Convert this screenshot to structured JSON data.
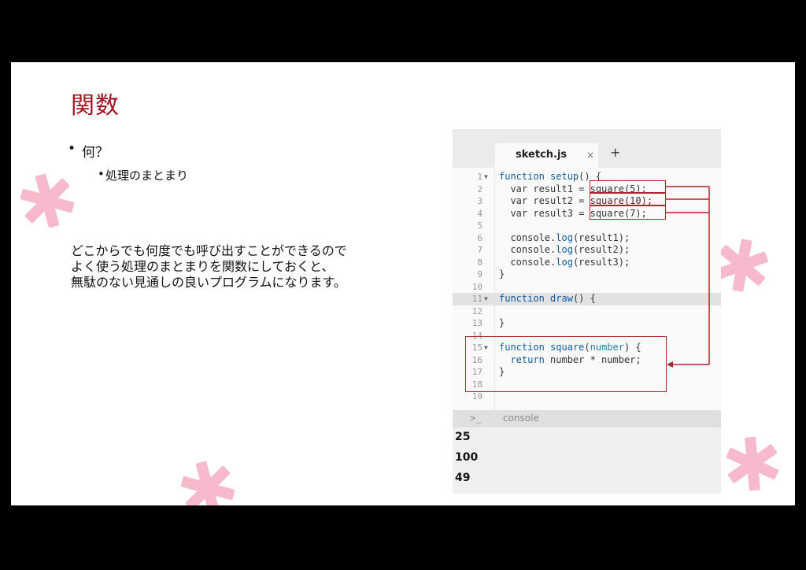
{
  "slide": {
    "title": "関数",
    "bullet1": "何？",
    "bullet2": "処理のまとまり",
    "paragraph": [
      "どこからでも何度でも呼び出すことができるので",
      "よく使う処理のまとまりを関数にしておくと、",
      "無駄のない見通しの良いプログラムになります。"
    ]
  },
  "editor": {
    "tab_name": "sketch.js",
    "tab_close": "×",
    "tab_add": "+",
    "lines": [
      {
        "n": "1",
        "fold": true
      },
      {
        "n": "2"
      },
      {
        "n": "3"
      },
      {
        "n": "4"
      },
      {
        "n": "5"
      },
      {
        "n": "6"
      },
      {
        "n": "7"
      },
      {
        "n": "8"
      },
      {
        "n": "9"
      },
      {
        "n": "10"
      },
      {
        "n": "11",
        "fold": true,
        "highlight": true
      },
      {
        "n": "12"
      },
      {
        "n": "13"
      },
      {
        "n": "14"
      },
      {
        "n": "15",
        "fold": true
      },
      {
        "n": "16"
      },
      {
        "n": "17"
      },
      {
        "n": "18"
      },
      {
        "n": "19"
      }
    ],
    "code": {
      "l1_kw": "function",
      "l1_fn": "setup",
      "l1_rest": "() {",
      "l2": "  var result1 = square(5);",
      "l3": "  var result2 = square(10);",
      "l4": "  var result3 = square(7);",
      "l6_a": "  console.",
      "l6_b": "log",
      "l6_c": "(result1);",
      "l7_a": "  console.",
      "l7_b": "log",
      "l7_c": "(result2);",
      "l8_a": "  console.",
      "l8_b": "log",
      "l8_c": "(result3);",
      "l9": "}",
      "l11_kw": "function",
      "l11_fn": "draw",
      "l11_rest": "() {",
      "l13": "}",
      "l15_kw": "function",
      "l15_fn": "square",
      "l15_p1": "(",
      "l15_pm": "number",
      "l15_p2": ") {",
      "l16_kw": "  return",
      "l16_rest": " number * number;",
      "l17": "}"
    },
    "console_prompt": ">_",
    "console_label": "console",
    "output": [
      "25",
      "100",
      "49"
    ]
  },
  "colors": {
    "accent": "#a4121e",
    "box": "#b3232b",
    "star": "#f7b9cc"
  }
}
